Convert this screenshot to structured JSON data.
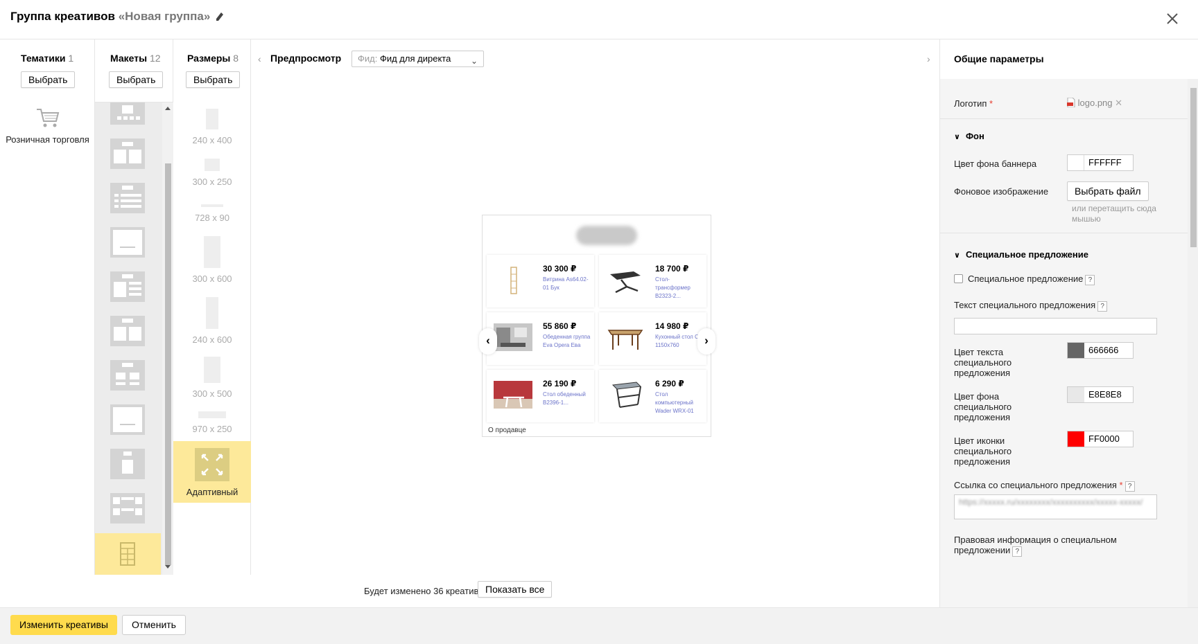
{
  "header": {
    "title": "Группа креативов",
    "group_name": "«Новая группа»"
  },
  "themes": {
    "title": "Тематики",
    "count": "1",
    "select_label": "Выбрать",
    "items": [
      {
        "label": "Розничная торговля",
        "icon": "cart-icon"
      }
    ]
  },
  "layouts": {
    "title": "Макеты",
    "count": "12",
    "select_label": "Выбрать"
  },
  "sizes": {
    "title": "Размеры",
    "count": "8",
    "select_label": "Выбрать",
    "items": [
      "240 x 400",
      "300 x 250",
      "728 x 90",
      "300 x 600",
      "240 x 600",
      "300 x 500",
      "970 x 250"
    ],
    "adaptive_label": "Адаптивный"
  },
  "preview": {
    "title": "Предпросмотр",
    "feed_prefix": "Фид:",
    "feed_value": "Фид для директа",
    "seller_link": "О продавце",
    "products": [
      {
        "price": "30 300 ₽",
        "name": "Витрина As64.02-01 Бук"
      },
      {
        "price": "18 700 ₽",
        "name": "Стол-трансформер B2323-2..."
      },
      {
        "price": "55 860 ₽",
        "name": "Обеденная группа Eva Opera Ева"
      },
      {
        "price": "14 980 ₽",
        "name": "Кухонный стол СТ 1150x760"
      },
      {
        "price": "26 190 ₽",
        "name": "Стол обеденный B2396-1..."
      },
      {
        "price": "6 290 ₽",
        "name": "Стол компьютерный Wader WRX-01"
      }
    ]
  },
  "panel": {
    "title": "Общие параметры",
    "logo_label": "Логотип",
    "logo_file": "logo.png",
    "bg_section": "Фон",
    "bg_color_label": "Цвет фона баннера",
    "bg_color_value": "FFFFFF",
    "bg_image_label": "Фоновое изображение",
    "choose_file_label": "Выбрать файл",
    "drag_hint": "или перетащить сюда мышью",
    "special_section": "Специальное предложение",
    "special_checkbox_label": "Специальное предложение",
    "special_text_label": "Текст специального предложения",
    "special_text_color_label": "Цвет текста специального предложения",
    "special_text_color_value": "666666",
    "special_bg_color_label": "Цвет фона специального предложения",
    "special_bg_color_value": "E8E8E8",
    "special_icon_color_label": "Цвет иконки специального предложения",
    "special_icon_color_value": "FF0000",
    "special_link_label": "Ссылка со специального предложения",
    "special_link_value": "https://xxxxx.ru/xxxxxxxx/xxxxxxxxxx/xxxxx-xxxxx/",
    "legal_label": "Правовая информация о специальном предложении",
    "help_mark": "?"
  },
  "footer": {
    "info_text": "Будет изменено 36 креативов",
    "show_all_label": "Показать все",
    "apply_label": "Изменить креативы",
    "cancel_label": "Отменить"
  },
  "colors": {
    "accent_yellow": "#ffdb4d",
    "selected_tile": "#fde99a",
    "swatch_white": "#FFFFFF",
    "swatch_gray": "#666666",
    "swatch_light": "#E8E8E8",
    "swatch_red": "#FF0000"
  }
}
